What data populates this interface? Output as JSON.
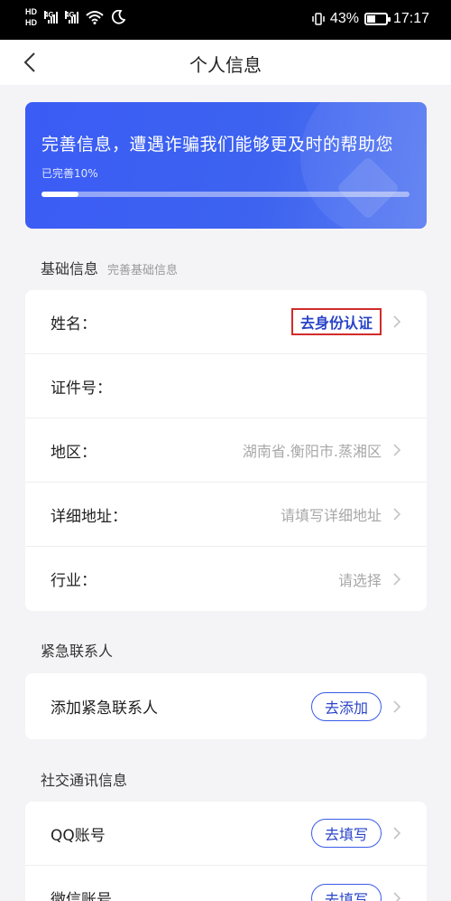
{
  "status_bar": {
    "hd_top": "HD",
    "hd_bottom": "HD",
    "sig1_label": "4G",
    "sig2_label": "4G",
    "battery_pct": "43%",
    "battery_level": 0.43,
    "time": "17:17"
  },
  "nav": {
    "title": "个人信息"
  },
  "banner": {
    "title": "完善信息，遭遇诈骗我们能够更及时的帮助您",
    "progress_label": "已完善10%",
    "progress": 0.1
  },
  "basic": {
    "title": "基础信息",
    "subtitle": "完善基础信息",
    "rows": [
      {
        "label": "姓名：",
        "action": "去身份认证"
      },
      {
        "label": "证件号：",
        "value": ""
      },
      {
        "label": "地区：",
        "value": "湖南省.衡阳市.蒸湘区"
      },
      {
        "label": "详细地址：",
        "value": "请填写详细地址"
      },
      {
        "label": "行业：",
        "value": "请选择"
      }
    ]
  },
  "emergency": {
    "title": "紧急联系人",
    "row_label": "添加紧急联系人",
    "button": "去添加"
  },
  "social": {
    "title": "社交通讯信息",
    "rows": [
      {
        "label": "QQ账号",
        "button": "去填写"
      },
      {
        "label": "微信账号",
        "button": "去填写"
      }
    ]
  }
}
